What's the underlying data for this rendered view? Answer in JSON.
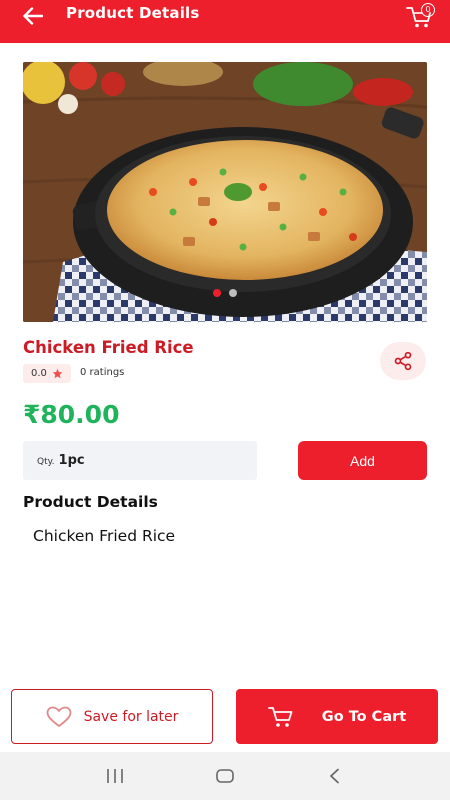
{
  "header": {
    "title": "Product Details",
    "cart_count": "0",
    "back_icon": "arrow-left-icon",
    "cart_icon": "cart-icon"
  },
  "product": {
    "name": "Chicken Fried Rice",
    "rating": "0.0",
    "ratings_text": "0 ratings",
    "price": "₹80.00",
    "carousel": {
      "count": 2,
      "active_index": 0
    }
  },
  "quantity": {
    "label": "Qty.",
    "value": "1pc"
  },
  "actions": {
    "add_label": "Add",
    "save_label": "Save for later",
    "go_to_cart_label": "Go To Cart"
  },
  "details": {
    "heading": "Product Details",
    "text": "Chicken Fried Rice"
  },
  "colors": {
    "brand_red": "#ee1f2c",
    "title_red": "#cc1b25",
    "price_green": "#1fb45c",
    "soft_pink": "#fdecec"
  }
}
